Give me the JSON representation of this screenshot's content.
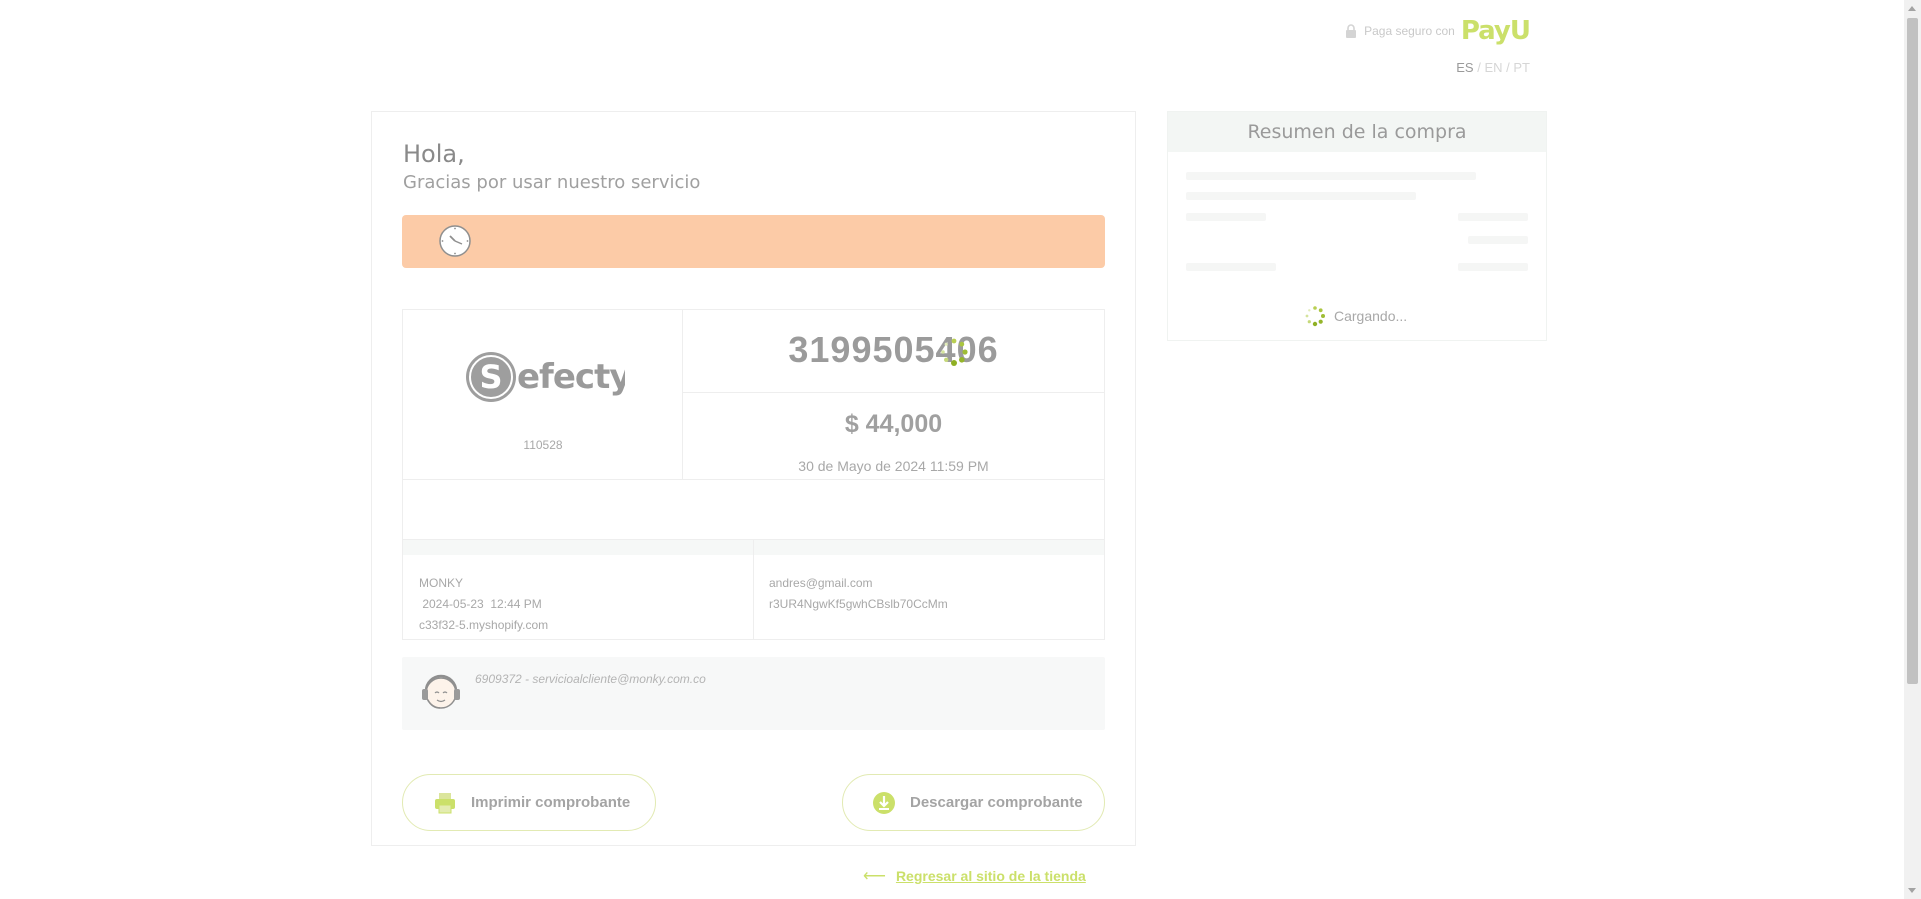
{
  "header": {
    "secure_text": "Paga seguro con",
    "brand": "PayU",
    "languages": [
      "ES",
      "EN",
      "PT"
    ],
    "language_separator": "/",
    "accent_color": "#cbe06a"
  },
  "greeting": {
    "hello": "Hola,",
    "thanks": "Gracias por usar nuestro servicio"
  },
  "status_banner": {
    "icon": "clock-icon",
    "color": "#fccba7"
  },
  "payment": {
    "method_logo_text": "efecty",
    "agreement_number": "110528",
    "reference_number": "3199505406",
    "amount": "$ 44,000",
    "due_date": "30 de Mayo de 2024 11:59 PM"
  },
  "order_details": {
    "merchant": "MONKY",
    "date": " 2024-05-23  12:44 PM",
    "site": "c33f32-5.myshopify.com",
    "email": "andres@gmail.com",
    "order_reference": "r3UR4NgwKf5gwhCBslb70CcMm"
  },
  "support": {
    "phone": "6909372 - ",
    "email": "servicioalcliente@monky.com.co"
  },
  "actions": {
    "print_label": "Imprimir comprobante",
    "download_label": "Descargar comprobante",
    "back_label": "Regresar al sitio de la tienda"
  },
  "summary": {
    "title": "Resumen de la compra",
    "loading_text": "Cargando..."
  }
}
